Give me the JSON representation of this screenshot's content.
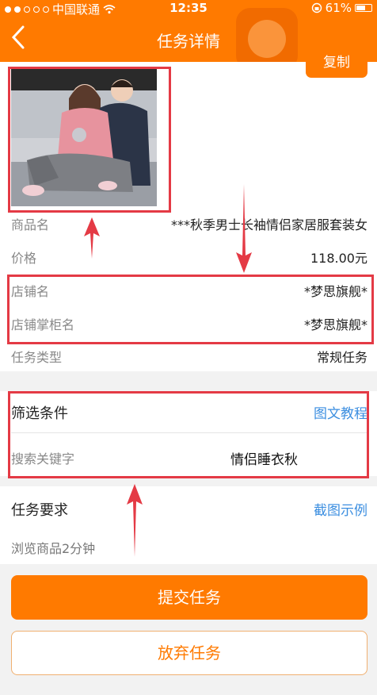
{
  "status_bar": {
    "carrier": "中国联通",
    "time": "12:35",
    "battery": "61%",
    "battery_level": 0.61
  },
  "nav": {
    "back_icon": "chevron-left-icon",
    "title": "任务详情"
  },
  "product": {
    "rows": [
      {
        "key": "商品名",
        "value": "***秋季男士长袖情侣家居服套装女"
      },
      {
        "key": "价格",
        "value": "118.00元"
      },
      {
        "key": "店铺名",
        "value": "*梦思旗舰*"
      },
      {
        "key": "店铺掌柜名",
        "value": "*梦思旗舰*"
      },
      {
        "key": "任务类型",
        "value": "常规任务"
      }
    ]
  },
  "filter": {
    "title": "筛选条件",
    "tutorial_link": "图文教程",
    "keyword_label": "搜索关键字",
    "keyword_value": "情侣睡衣秋",
    "copy_label": "复制"
  },
  "requirement": {
    "title": "任务要求",
    "example_link": "截图示例",
    "description": "浏览商品2分钟"
  },
  "actions": {
    "submit_label": "提交任务",
    "abandon_label": "放弃任务"
  },
  "colors": {
    "accent": "#ff7a00",
    "link": "#3b8ee0",
    "annotation": "#e43a45"
  }
}
